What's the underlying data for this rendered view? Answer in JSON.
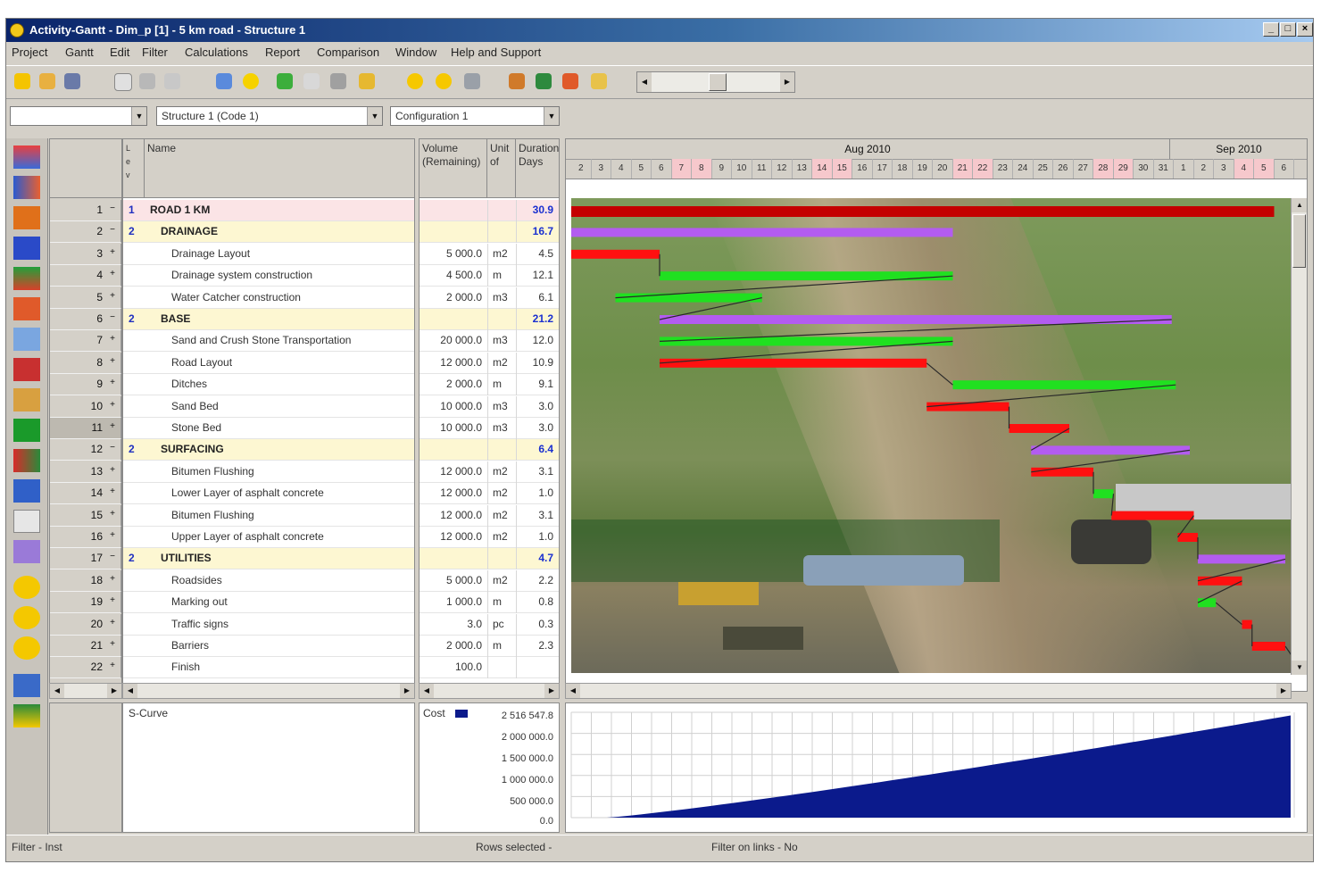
{
  "window": {
    "title": "Activity-Gantt - Dim_p [1] - 5 km road - Structure 1"
  },
  "menu": [
    "Project",
    "Gantt",
    "Edit",
    "Filter",
    "Calculations",
    "Report",
    "Comparison",
    "Window",
    "Help and Support"
  ],
  "selectors": {
    "left": "",
    "structure": "Structure 1 (Code 1)",
    "configuration": "Configuration 1"
  },
  "columns": {
    "name": "Name",
    "volume": "Volume (Remaining)",
    "unit": "Unit of",
    "duration": "Duration, Days"
  },
  "timeline": {
    "months": [
      "Aug 2010",
      "Sep 2010"
    ],
    "days": [
      "2",
      "3",
      "4",
      "5",
      "6",
      "7",
      "8",
      "9",
      "10",
      "11",
      "12",
      "13",
      "14",
      "15",
      "16",
      "17",
      "18",
      "19",
      "20",
      "21",
      "22",
      "23",
      "24",
      "25",
      "26",
      "27",
      "28",
      "29",
      "30",
      "31",
      "1",
      "2",
      "3",
      "4",
      "5",
      "6"
    ],
    "weekend_idx": [
      5,
      6,
      12,
      13,
      19,
      20,
      26,
      27,
      33,
      34
    ]
  },
  "rows": [
    {
      "n": "1",
      "level": 0,
      "num": "1",
      "name": "ROAD 1 KM",
      "vol": "",
      "unit": "",
      "dur": "30.9",
      "type": "root"
    },
    {
      "n": "2",
      "level": 1,
      "num": "2",
      "name": "DRAINAGE",
      "vol": "",
      "unit": "",
      "dur": "16.7",
      "type": "group"
    },
    {
      "n": "3",
      "level": 2,
      "num": "",
      "name": "Drainage Layout",
      "vol": "5 000.0",
      "unit": "m2",
      "dur": "4.5",
      "type": "task"
    },
    {
      "n": "4",
      "level": 2,
      "num": "",
      "name": "Drainage system construction",
      "vol": "4 500.0",
      "unit": "m",
      "dur": "12.1",
      "type": "task"
    },
    {
      "n": "5",
      "level": 2,
      "num": "",
      "name": "Water Catcher construction",
      "vol": "2 000.0",
      "unit": "m3",
      "dur": "6.1",
      "type": "task"
    },
    {
      "n": "6",
      "level": 1,
      "num": "2",
      "name": "BASE",
      "vol": "",
      "unit": "",
      "dur": "21.2",
      "type": "group"
    },
    {
      "n": "7",
      "level": 2,
      "num": "",
      "name": "Sand and Crush Stone Transportation",
      "vol": "20 000.0",
      "unit": "m3",
      "dur": "12.0",
      "type": "task"
    },
    {
      "n": "8",
      "level": 2,
      "num": "",
      "name": "Road Layout",
      "vol": "12 000.0",
      "unit": "m2",
      "dur": "10.9",
      "type": "task"
    },
    {
      "n": "9",
      "level": 2,
      "num": "",
      "name": "Ditches",
      "vol": "2 000.0",
      "unit": "m",
      "dur": "9.1",
      "type": "task"
    },
    {
      "n": "10",
      "level": 2,
      "num": "",
      "name": "Sand Bed",
      "vol": "10 000.0",
      "unit": "m3",
      "dur": "3.0",
      "type": "task"
    },
    {
      "n": "11",
      "level": 2,
      "num": "",
      "name": "Stone Bed",
      "vol": "10 000.0",
      "unit": "m3",
      "dur": "3.0",
      "type": "task"
    },
    {
      "n": "12",
      "level": 1,
      "num": "2",
      "name": "SURFACING",
      "vol": "",
      "unit": "",
      "dur": "6.4",
      "type": "group"
    },
    {
      "n": "13",
      "level": 2,
      "num": "",
      "name": "Bitumen Flushing",
      "vol": "12 000.0",
      "unit": "m2",
      "dur": "3.1",
      "type": "task"
    },
    {
      "n": "14",
      "level": 2,
      "num": "",
      "name": "Lower Layer of asphalt concrete",
      "vol": "12 000.0",
      "unit": "m2",
      "dur": "1.0",
      "type": "task"
    },
    {
      "n": "15",
      "level": 2,
      "num": "",
      "name": "Bitumen Flushing",
      "vol": "12 000.0",
      "unit": "m2",
      "dur": "3.1",
      "type": "task"
    },
    {
      "n": "16",
      "level": 2,
      "num": "",
      "name": "Upper Layer of asphalt concrete",
      "vol": "12 000.0",
      "unit": "m2",
      "dur": "1.0",
      "type": "task"
    },
    {
      "n": "17",
      "level": 1,
      "num": "2",
      "name": "UTILITIES",
      "vol": "",
      "unit": "",
      "dur": "4.7",
      "type": "group"
    },
    {
      "n": "18",
      "level": 2,
      "num": "",
      "name": "Roadsides",
      "vol": "5 000.0",
      "unit": "m2",
      "dur": "2.2",
      "type": "task"
    },
    {
      "n": "19",
      "level": 2,
      "num": "",
      "name": "Marking out",
      "vol": "1 000.0",
      "unit": "m",
      "dur": "0.8",
      "type": "task"
    },
    {
      "n": "20",
      "level": 2,
      "num": "",
      "name": "Traffic signs",
      "vol": "3.0",
      "unit": "pc",
      "dur": "0.3",
      "type": "task"
    },
    {
      "n": "21",
      "level": 2,
      "num": "",
      "name": "Barriers",
      "vol": "2 000.0",
      "unit": "m",
      "dur": "2.3",
      "type": "task"
    },
    {
      "n": "22",
      "level": 2,
      "num": "",
      "name": "Finish",
      "vol": "100.0",
      "unit": "",
      "dur": "",
      "type": "task"
    }
  ],
  "gantt": [
    {
      "start": 0,
      "len": 35,
      "color": "#c40000"
    },
    {
      "start": 0,
      "len": 19,
      "color": "#b35cf0"
    },
    {
      "start": 0,
      "len": 4.4,
      "color": "#ff1010"
    },
    {
      "start": 4.4,
      "len": 14.6,
      "color": "#20e020"
    },
    {
      "start": 2.2,
      "len": 7.3,
      "color": "#20e020"
    },
    {
      "start": 4.4,
      "len": 25.5,
      "color": "#b35cf0"
    },
    {
      "start": 4.4,
      "len": 14.6,
      "color": "#20e020"
    },
    {
      "start": 4.4,
      "len": 13.3,
      "color": "#ff1010"
    },
    {
      "start": 19,
      "len": 11.1,
      "color": "#20e020"
    },
    {
      "start": 17.7,
      "len": 4.1,
      "color": "#ff1010"
    },
    {
      "start": 21.8,
      "len": 3.0,
      "color": "#ff1010"
    },
    {
      "start": 22.9,
      "len": 7.9,
      "color": "#b35cf0"
    },
    {
      "start": 22.9,
      "len": 3.1,
      "color": "#ff1010"
    },
    {
      "start": 26.0,
      "len": 1.0,
      "color": "#20e020"
    },
    {
      "start": 26.9,
      "len": 4.1,
      "color": "#ff1010"
    },
    {
      "start": 30.2,
      "len": 1.0,
      "color": "#ff1010"
    },
    {
      "start": 31.2,
      "len": 5.4,
      "color": "#b35cf0"
    },
    {
      "start": 31.2,
      "len": 2.2,
      "color": "#ff1010"
    },
    {
      "start": 31.2,
      "len": 0.9,
      "color": "#20e020"
    },
    {
      "start": 33.4,
      "len": 0.5,
      "color": "#ff1010"
    },
    {
      "start": 33.9,
      "len": 2.5,
      "color": "#ff1010"
    },
    {
      "start": 36.3,
      "len": 0.3,
      "color": "#ff1010"
    }
  ],
  "scurve": {
    "label": "S-Curve",
    "legend": "Cost",
    "ticks": [
      "2 516 547.8",
      "2 000 000.0",
      "1 500 000.0",
      "1 000 000.0",
      "500 000.0",
      "0.0"
    ],
    "fill_color": "#0b1a8c"
  },
  "status": {
    "filter": "Filter - Inst",
    "rows": "Rows selected -",
    "filter_links": "Filter on links - No"
  }
}
